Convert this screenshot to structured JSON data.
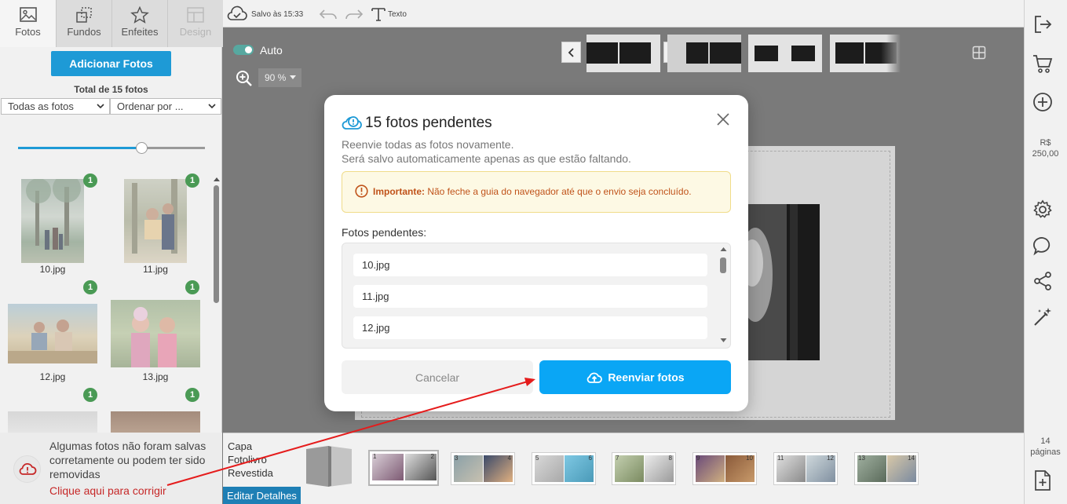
{
  "left_panel": {
    "tabs": [
      {
        "label": "Fotos",
        "icon": "image-icon"
      },
      {
        "label": "Fundos",
        "icon": "background-icon"
      },
      {
        "label": "Enfeites",
        "icon": "star-icon"
      },
      {
        "label": "Design",
        "icon": "layout-icon"
      }
    ],
    "add_button": "Adicionar Fotos",
    "total": "Total de 15 fotos",
    "filter": "Todas as fotos",
    "sort": "Ordenar por ...",
    "photos": [
      {
        "name": "10.jpg",
        "badge": "1"
      },
      {
        "name": "11.jpg",
        "badge": "1"
      },
      {
        "name": "12.jpg",
        "badge": "1"
      },
      {
        "name": "13.jpg",
        "badge": "1"
      },
      {
        "badge": "1"
      },
      {
        "badge": "1"
      }
    ],
    "warning": {
      "text": "Algumas fotos não foram salvas corretamente ou podem ter sido removidas",
      "link": "Clique aqui para corrigir"
    }
  },
  "toolbar": {
    "saved": "Salvo às 15:33",
    "text_tool": "Texto"
  },
  "canvas": {
    "auto_label": "Auto",
    "zoom": "90 %"
  },
  "right_panel": {
    "currency": "R$",
    "price": "250,00",
    "pages_count": "14",
    "pages_label": "páginas"
  },
  "bottom": {
    "cover_line1": "Capa",
    "cover_line2": "Fotolivro",
    "cover_line3": "Revestida",
    "edit_details": "Editar Detalhes",
    "spreads": [
      {
        "left": "1",
        "right": "2"
      },
      {
        "left": "3",
        "right": "4"
      },
      {
        "left": "5",
        "right": "6"
      },
      {
        "left": "7",
        "right": "8"
      },
      {
        "left": "9",
        "right": "10"
      },
      {
        "left": "11",
        "right": "12"
      },
      {
        "left": "13",
        "right": "14"
      }
    ]
  },
  "modal": {
    "title": "15 fotos pendentes",
    "desc1": "Reenvie todas as fotos novamente.",
    "desc2": "Será salvo automaticamente apenas as que estão faltando.",
    "alert_strong": "Importante:",
    "alert_text": " Não feche a guia do navegador até que o envio seja concluído.",
    "pending_label": "Fotos pendentes:",
    "files": [
      "10.jpg",
      "11.jpg",
      "12.jpg"
    ],
    "cancel": "Cancelar",
    "resend": "Reenviar fotos"
  },
  "colors": {
    "accent": "#1e9ad6",
    "resend": "#0aa6f5",
    "badge": "#4a9a55",
    "warning_link": "#c62828",
    "alert_text": "#c0531a"
  }
}
